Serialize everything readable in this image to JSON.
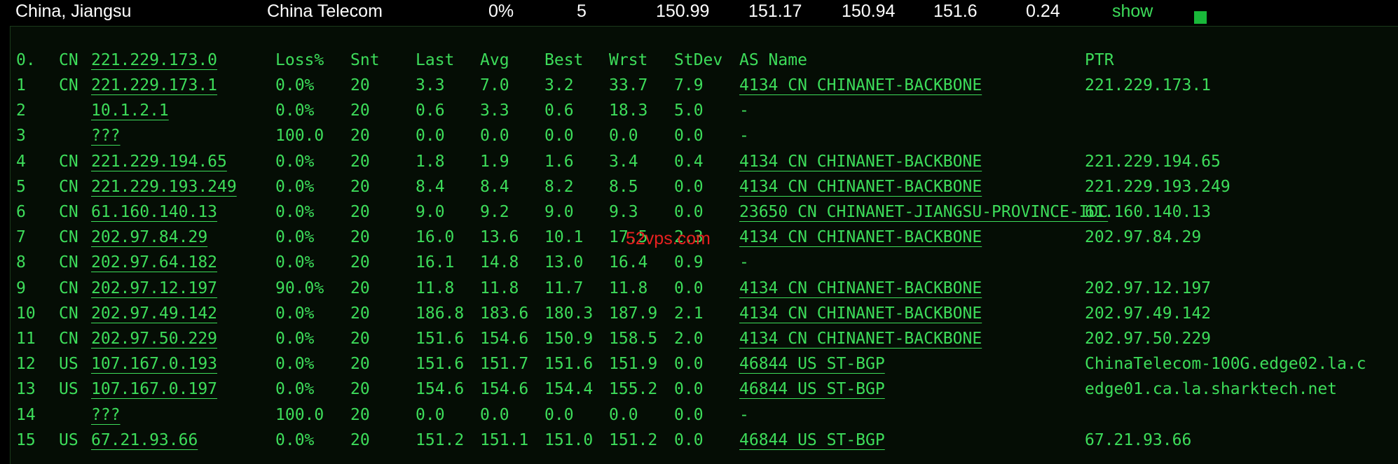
{
  "summary": {
    "location": "China, Jiangsu",
    "isp": "China Telecom",
    "loss": "0%",
    "sent": "5",
    "last": "150.99",
    "avg": "151.17",
    "best": "150.94",
    "worst": "151.6",
    "stdev": "0.24",
    "show_label": "show"
  },
  "header": {
    "index": "0.",
    "cc": "CN",
    "host": "221.229.173.0",
    "loss": "Loss%",
    "snt": "Snt",
    "last": "Last",
    "avg": "Avg",
    "best": "Best",
    "wrst": "Wrst",
    "stdev": "StDev",
    "asname": "AS Name",
    "ptr": "PTR"
  },
  "hops": [
    {
      "n": "1",
      "cc": "CN",
      "host": "221.229.173.1",
      "loss": "0.0%",
      "snt": "20",
      "last": "3.3",
      "avg": "7.0",
      "best": "3.2",
      "wrst": "33.7",
      "stdev": "7.9",
      "as": "4134  CN CHINANET-BACKBONE",
      "ptr": "221.229.173.1"
    },
    {
      "n": "2",
      "cc": "",
      "host": "10.1.2.1",
      "loss": "0.0%",
      "snt": "20",
      "last": "0.6",
      "avg": "3.3",
      "best": "0.6",
      "wrst": "18.3",
      "stdev": "5.0",
      "as": "-",
      "ptr": ""
    },
    {
      "n": "3",
      "cc": "",
      "host": "???",
      "loss": "100.0",
      "snt": "20",
      "last": "0.0",
      "avg": "0.0",
      "best": "0.0",
      "wrst": "0.0",
      "stdev": "0.0",
      "as": "-",
      "ptr": ""
    },
    {
      "n": "4",
      "cc": "CN",
      "host": "221.229.194.65",
      "loss": "0.0%",
      "snt": "20",
      "last": "1.8",
      "avg": "1.9",
      "best": "1.6",
      "wrst": "3.4",
      "stdev": "0.4",
      "as": "4134  CN CHINANET-BACKBONE",
      "ptr": "221.229.194.65"
    },
    {
      "n": "5",
      "cc": "CN",
      "host": "221.229.193.249",
      "loss": "0.0%",
      "snt": "20",
      "last": "8.4",
      "avg": "8.4",
      "best": "8.2",
      "wrst": "8.5",
      "stdev": "0.0",
      "as": "4134  CN CHINANET-BACKBONE",
      "ptr": "221.229.193.249"
    },
    {
      "n": "6",
      "cc": "CN",
      "host": "61.160.140.13",
      "loss": "0.0%",
      "snt": "20",
      "last": "9.0",
      "avg": "9.2",
      "best": "9.0",
      "wrst": "9.3",
      "stdev": "0.0",
      "as": "23650 CN CHINANET-JIANGSU-PROVINCE-IDC",
      "ptr": "61.160.140.13"
    },
    {
      "n": "7",
      "cc": "CN",
      "host": "202.97.84.29",
      "loss": "0.0%",
      "snt": "20",
      "last": "16.0",
      "avg": "13.6",
      "best": "10.1",
      "wrst": "17.5",
      "stdev": "2.3",
      "as": "4134  CN CHINANET-BACKBONE",
      "ptr": "202.97.84.29"
    },
    {
      "n": "8",
      "cc": "CN",
      "host": "202.97.64.182",
      "loss": "0.0%",
      "snt": "20",
      "last": "16.1",
      "avg": "14.8",
      "best": "13.0",
      "wrst": "16.4",
      "stdev": "0.9",
      "as": "-",
      "ptr": ""
    },
    {
      "n": "9",
      "cc": "CN",
      "host": "202.97.12.197",
      "loss": "90.0%",
      "snt": "20",
      "last": "11.8",
      "avg": "11.8",
      "best": "11.7",
      "wrst": "11.8",
      "stdev": "0.0",
      "as": "4134  CN CHINANET-BACKBONE",
      "ptr": "202.97.12.197"
    },
    {
      "n": "10",
      "cc": "CN",
      "host": "202.97.49.142",
      "loss": "0.0%",
      "snt": "20",
      "last": "186.8",
      "avg": "183.6",
      "best": "180.3",
      "wrst": "187.9",
      "stdev": "2.1",
      "as": "4134  CN CHINANET-BACKBONE",
      "ptr": "202.97.49.142"
    },
    {
      "n": "11",
      "cc": "CN",
      "host": "202.97.50.229",
      "loss": "0.0%",
      "snt": "20",
      "last": "151.6",
      "avg": "154.6",
      "best": "150.9",
      "wrst": "158.5",
      "stdev": "2.0",
      "as": "4134  CN CHINANET-BACKBONE",
      "ptr": "202.97.50.229"
    },
    {
      "n": "12",
      "cc": "US",
      "host": "107.167.0.193",
      "loss": "0.0%",
      "snt": "20",
      "last": "151.6",
      "avg": "151.7",
      "best": "151.6",
      "wrst": "151.9",
      "stdev": "0.0",
      "as": "46844 US ST-BGP",
      "ptr": "ChinaTelecom-100G.edge02.la.c"
    },
    {
      "n": "13",
      "cc": "US",
      "host": "107.167.0.197",
      "loss": "0.0%",
      "snt": "20",
      "last": "154.6",
      "avg": "154.6",
      "best": "154.4",
      "wrst": "155.2",
      "stdev": "0.0",
      "as": "46844 US ST-BGP",
      "ptr": "edge01.ca.la.sharktech.net"
    },
    {
      "n": "14",
      "cc": "",
      "host": "???",
      "loss": "100.0",
      "snt": "20",
      "last": "0.0",
      "avg": "0.0",
      "best": "0.0",
      "wrst": "0.0",
      "stdev": "0.0",
      "as": "-",
      "ptr": ""
    },
    {
      "n": "15",
      "cc": "US",
      "host": "67.21.93.66",
      "loss": "0.0%",
      "snt": "20",
      "last": "151.2",
      "avg": "151.1",
      "best": "151.0",
      "wrst": "151.2",
      "stdev": "0.0",
      "as": "46844 US ST-BGP",
      "ptr": "67.21.93.66"
    }
  ],
  "watermark": "52vps.com",
  "colors": {
    "text": "#3ddc5a",
    "background": "#000000",
    "watermark": "#e82020",
    "indicator": "#19b83a"
  }
}
